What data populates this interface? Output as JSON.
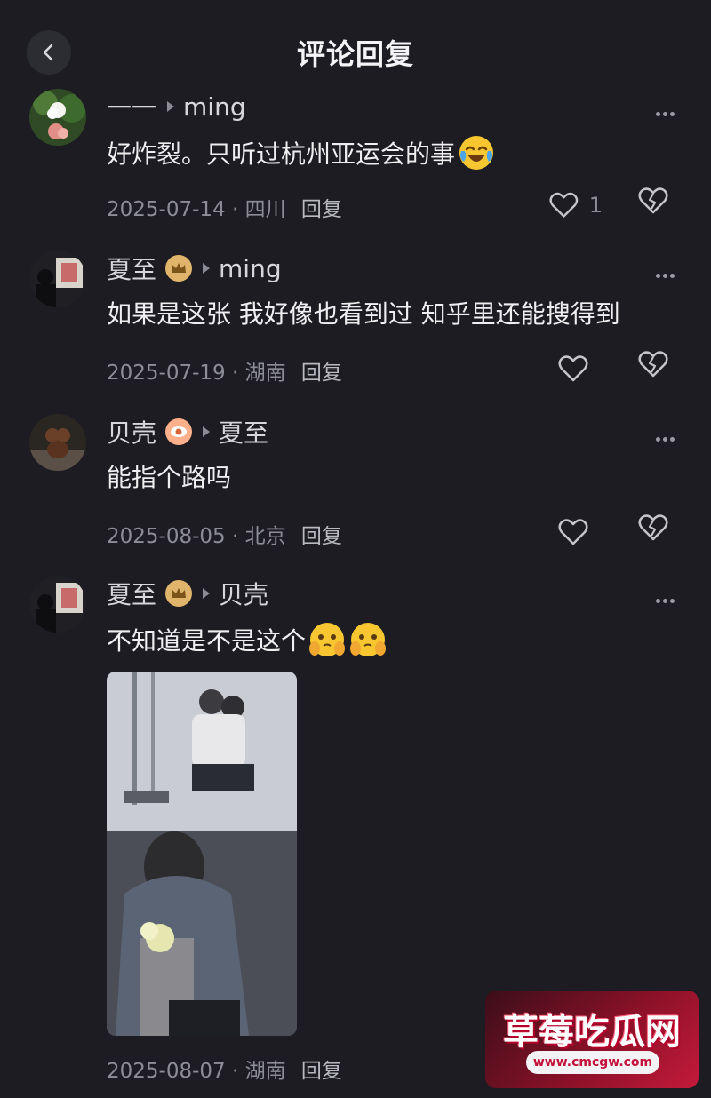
{
  "header": {
    "title": "评论回复",
    "back_icon": "chevron-left-icon"
  },
  "comments": [
    {
      "author": "一一",
      "reply_to": "ming",
      "badge": null,
      "text": "好炸裂。只听过杭州亚运会的事",
      "emoji": "crying-laughing-face-emoji",
      "date": "2025-07-14",
      "location": "四川",
      "reply_label": "回复",
      "likes": "1"
    },
    {
      "author": "夏至",
      "reply_to": "ming",
      "badge": "crown-badge-icon",
      "text": "如果是这张  我好像也看到过  知乎里还能搜得到",
      "date": "2025-07-19",
      "location": "湖南",
      "reply_label": "回复",
      "likes": ""
    },
    {
      "author": "贝壳",
      "reply_to": "夏至",
      "badge": "eye-badge-icon",
      "text": "能指个路吗",
      "date": "2025-08-05",
      "location": "北京",
      "reply_label": "回复",
      "likes": ""
    },
    {
      "author": "夏至",
      "reply_to": "贝壳",
      "badge": "crown-badge-icon",
      "text": "不知道是不是这个",
      "emoji": "face-holding-back-tears-emoji",
      "date": "2025-08-07",
      "location": "湖南",
      "reply_label": "回复",
      "has_image": true
    }
  ],
  "watermark": {
    "title": "草莓吃瓜网",
    "url": "www.cmcgw.com"
  },
  "colors": {
    "background": "#1c1c22",
    "text": "#efeff2",
    "muted": "#8d8d95",
    "crown_badge": "#e0b56b"
  }
}
